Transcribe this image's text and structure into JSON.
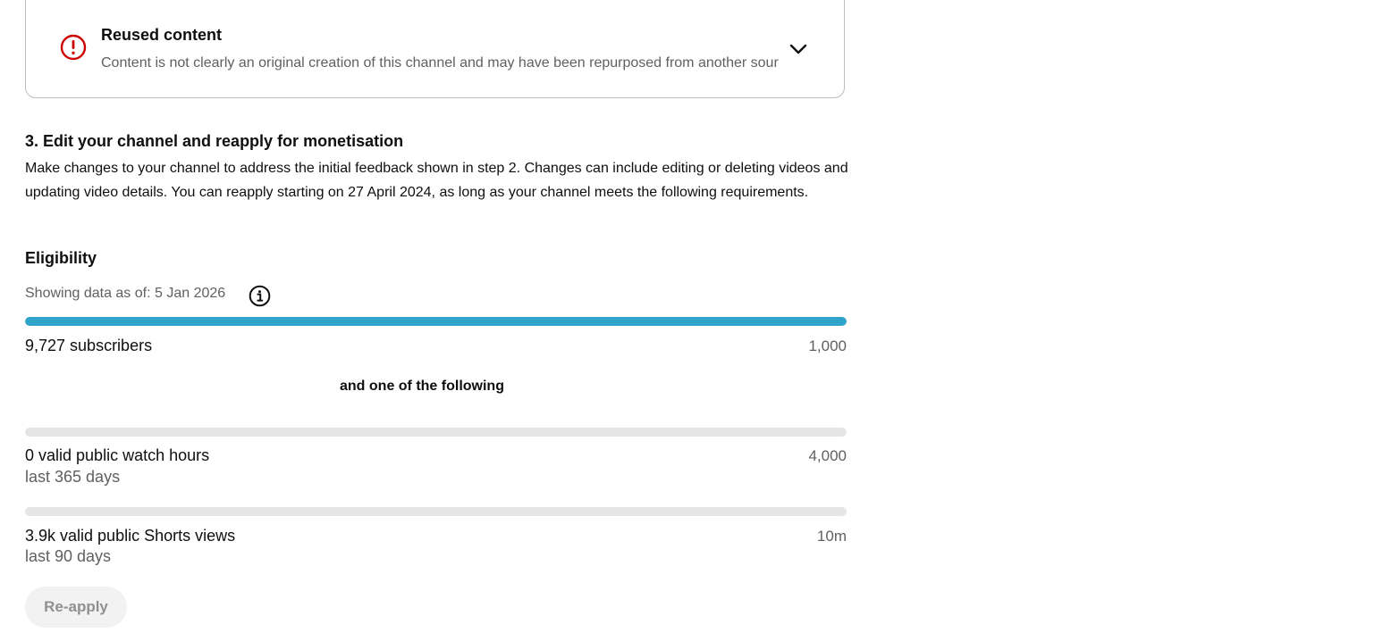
{
  "feedback_card": {
    "title": "Reused content",
    "description": "Content is not clearly an original creation of this channel and may have been repurposed from another source",
    "icon": "alert-circle-icon",
    "icon_color": "#cc0000",
    "toggle_icon": "chevron-down-icon"
  },
  "step3": {
    "title": "3. Edit your channel and reapply for monetisation",
    "body": "Make changes to your channel to address the initial feedback shown in step 2. Changes can include editing or deleting videos and updating video details. You can reapply starting on 27 April 2024, as long as your channel meets the following requirements."
  },
  "eligibility": {
    "title": "Eligibility",
    "as_of": "Showing data as of: 5 Jan 2026",
    "info_icon": "info-icon",
    "accent_color": "#2fa3c9",
    "subscribers": {
      "label": "9,727 subscribers",
      "target": "1,000",
      "progress": 1.0
    },
    "connector": "and one of the following",
    "watch_hours": {
      "label": "0 valid public watch hours",
      "period": "last 365 days",
      "target": "4,000",
      "progress": 0.0
    },
    "shorts_views": {
      "label": "3.9k valid public Shorts views",
      "period": "last 90 days",
      "target": "10m",
      "progress": 0.0
    }
  },
  "reapply_button": {
    "label": "Re-apply",
    "disabled": true
  }
}
